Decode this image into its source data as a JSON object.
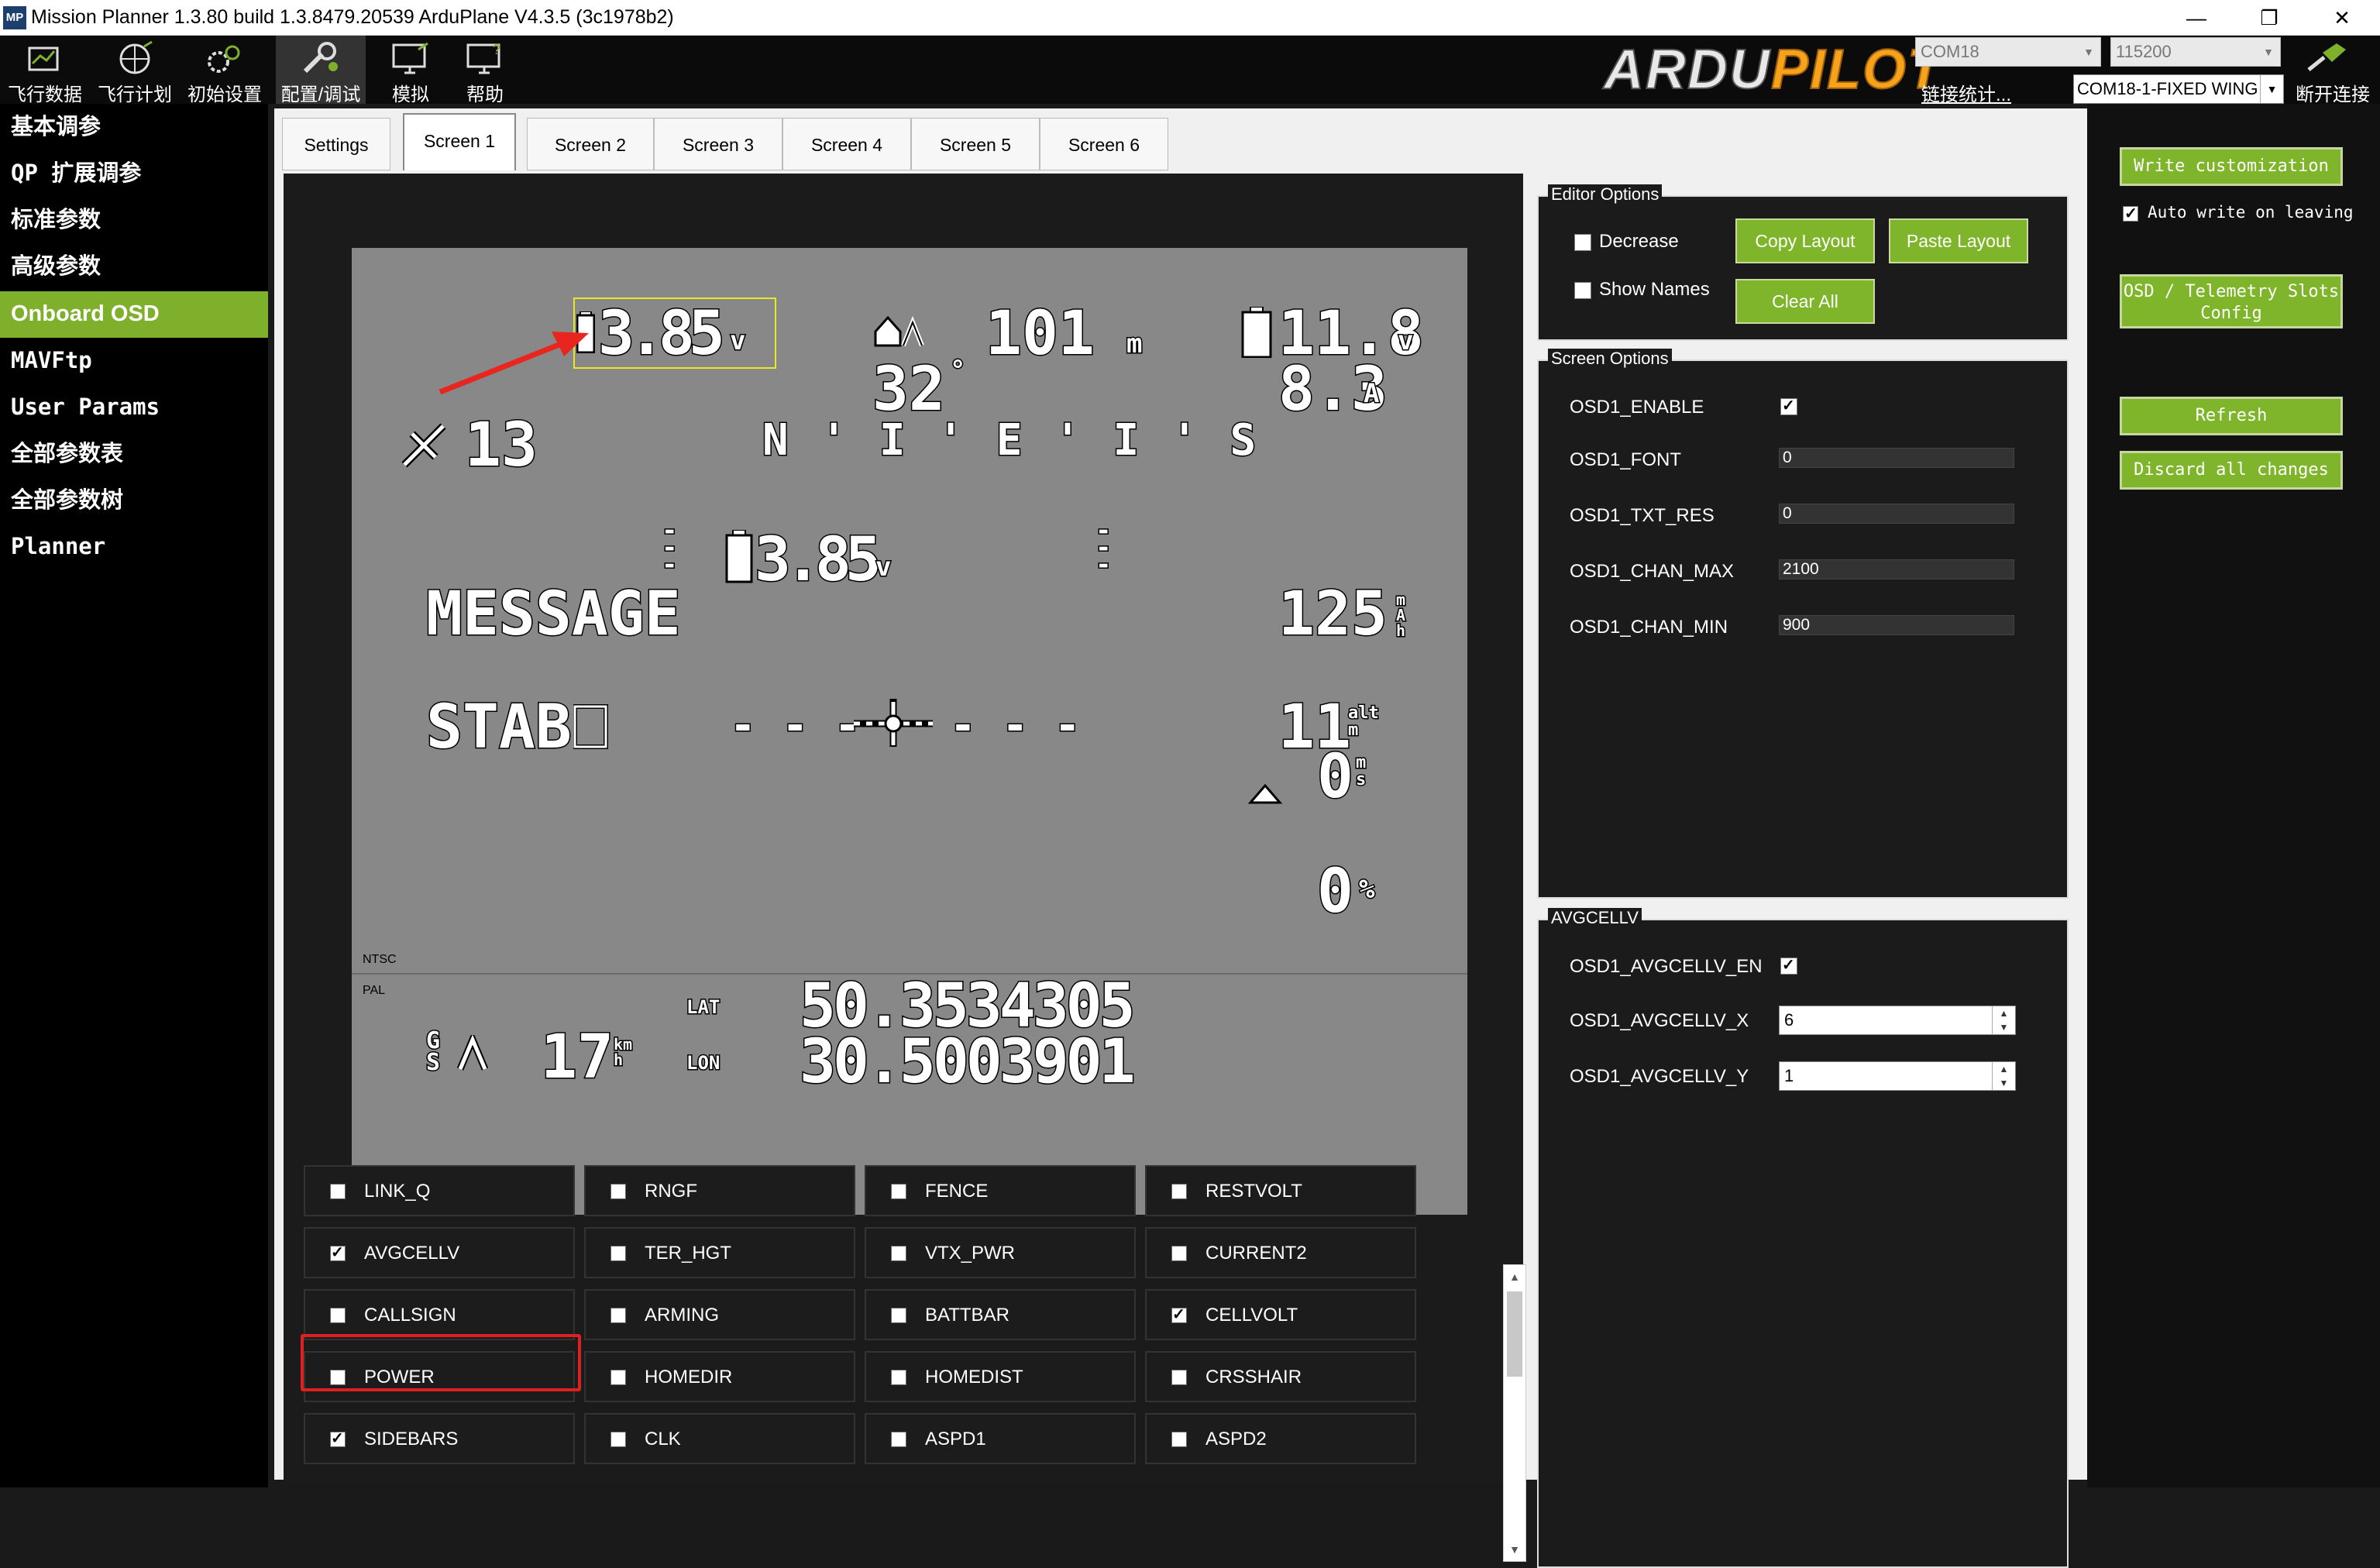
{
  "window": {
    "app_icon": "MP",
    "title": "Mission Planner 1.3.80 build 1.3.8479.20539 ArduPlane V4.3.5 (3c1978b2)",
    "min_icon": "minimize-icon",
    "restore_icon": "restore-icon",
    "close_icon": "close-icon"
  },
  "menu": {
    "items": [
      {
        "label": "飞行数据",
        "icon": "flight-data-icon"
      },
      {
        "label": "飞行计划",
        "icon": "flight-plan-icon"
      },
      {
        "label": "初始设置",
        "icon": "initial-setup-icon"
      },
      {
        "label": "配置/调试",
        "icon": "config-tuning-icon"
      },
      {
        "label": "模拟",
        "icon": "simulation-icon"
      },
      {
        "label": "帮助",
        "icon": "help-icon"
      }
    ],
    "logo_text_1": "ARDU",
    "logo_text_2": "PILOT",
    "com_port": "COM18",
    "baud": "115200",
    "link_stats": "链接统计...",
    "connection": "COM18-1-FIXED WING",
    "disconnect_label": "断开连接",
    "colors": {
      "accent": "#7eb02c",
      "logo_orange": "#f7a21b"
    }
  },
  "sidebar": {
    "items": [
      "基本调参",
      "QP 扩展调参",
      "标准参数",
      "高级参数",
      "Onboard OSD",
      "MAVFtp",
      "User Params",
      "全部参数表",
      "全部参数树",
      "Planner"
    ],
    "active_index": 4
  },
  "tabs": [
    "Settings",
    "Screen 1",
    "Screen 2",
    "Screen 3",
    "Screen 4",
    "Screen 5",
    "Screen 6"
  ],
  "active_tab": 1,
  "osd": {
    "avgcell": "3.85",
    "avgcell_unit": "v",
    "home_dist": "101",
    "home_unit": "m",
    "batt_volt": "11.8",
    "batt_unit": "v",
    "heading": "32",
    "heading_unit": "°",
    "current": "8.3",
    "current_unit": "A",
    "sats": "13",
    "compass": "N ' I ' E ' I ' S",
    "cellvolt": "3.85",
    "cellvolt_unit": "v",
    "message": "MESSAGE",
    "mah": "125",
    "mode": "STAB",
    "horizon_left": "- - -",
    "horizon_right": "- - -",
    "alt": "11",
    "vspd": "0",
    "throttle": "0",
    "throttle_unit": "%",
    "ntsc": "NTSC",
    "pal": "PAL",
    "gspd": "17",
    "lat_label": "LAT",
    "lon_label": "LON",
    "lat": "50.3534305",
    "lon": "30.5003901"
  },
  "checkboxes": [
    {
      "label": "LINK_Q",
      "checked": false
    },
    {
      "label": "RNGF",
      "checked": false
    },
    {
      "label": "FENCE",
      "checked": false
    },
    {
      "label": "RESTVOLT",
      "checked": false
    },
    {
      "label": "AVGCELLV",
      "checked": true
    },
    {
      "label": "TER_HGT",
      "checked": false
    },
    {
      "label": "VTX_PWR",
      "checked": false
    },
    {
      "label": "CURRENT2",
      "checked": false
    },
    {
      "label": "CALLSIGN",
      "checked": false
    },
    {
      "label": "ARMING",
      "checked": false
    },
    {
      "label": "BATTBAR",
      "checked": false
    },
    {
      "label": "CELLVOLT",
      "checked": true
    },
    {
      "label": "POWER",
      "checked": false
    },
    {
      "label": "HOMEDIR",
      "checked": false
    },
    {
      "label": "HOMEDIST",
      "checked": false
    },
    {
      "label": "CRSSHAIR",
      "checked": false
    },
    {
      "label": "SIDEBARS",
      "checked": true
    },
    {
      "label": "CLK",
      "checked": false
    },
    {
      "label": "ASPD1",
      "checked": false
    },
    {
      "label": "ASPD2",
      "checked": false
    }
  ],
  "editor_options": {
    "title": "Editor Options",
    "decrease": "Decrease",
    "show_names": "Show Names",
    "copy_layout": "Copy Layout",
    "paste_layout": "Paste Layout",
    "clear_all": "Clear All"
  },
  "screen_options": {
    "title": "Screen Options",
    "rows": [
      {
        "name": "OSD1_ENABLE",
        "value": ""
      },
      {
        "name": "OSD1_FONT",
        "value": "0"
      },
      {
        "name": "OSD1_TXT_RES",
        "value": "0"
      },
      {
        "name": "OSD1_CHAN_MAX",
        "value": "2100"
      },
      {
        "name": "OSD1_CHAN_MIN",
        "value": "900"
      }
    ]
  },
  "avgcellv_group": {
    "title": "AVGCELLV",
    "en_label": "OSD1_AVGCELLV_EN",
    "x_label": "OSD1_AVGCELLV_X",
    "x_value": "6",
    "y_label": "OSD1_AVGCELLV_Y",
    "y_value": "1"
  },
  "right_panel": {
    "write_custom": "Write customization",
    "auto_write": "Auto write on leaving",
    "slots_config_1": "OSD / Telemetry Slots",
    "slots_config_2": "Config",
    "refresh": "Refresh",
    "discard": "Discard all changes"
  }
}
